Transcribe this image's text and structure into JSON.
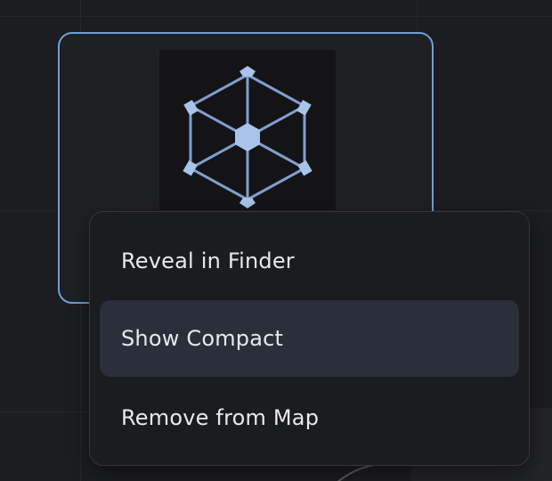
{
  "canvas": {
    "background": "#1c1d20"
  },
  "node": {
    "icon": "hexagon-hub-icon",
    "accent_color": "#6f9fd6",
    "selected": true
  },
  "context_menu": {
    "items": [
      {
        "label": "Reveal in Finder",
        "highlighted": false
      },
      {
        "label": "Show Compact",
        "highlighted": true
      },
      {
        "label": "Remove from Map",
        "highlighted": false
      }
    ],
    "highlight_color": "#2b2f3a"
  }
}
